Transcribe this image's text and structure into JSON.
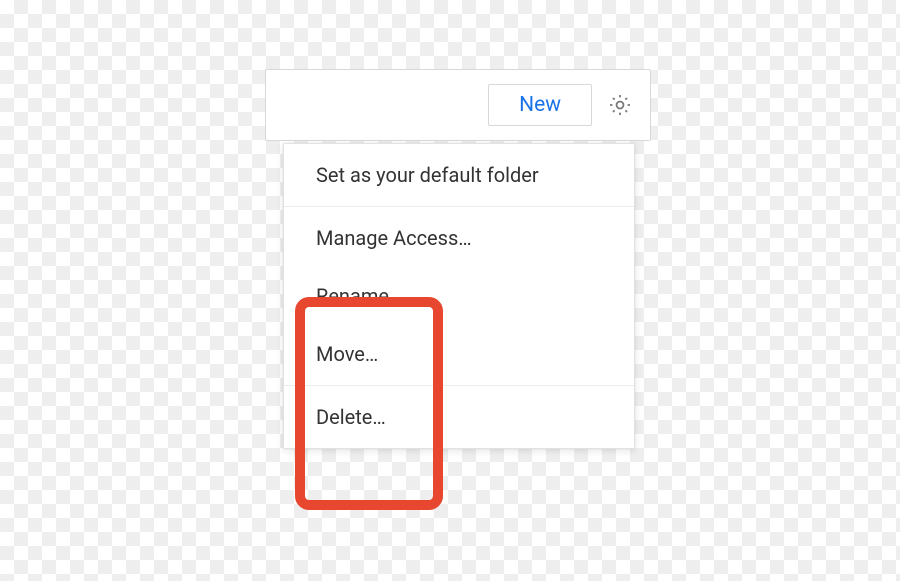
{
  "toolbar": {
    "new_label": "New"
  },
  "menu": {
    "set_default": "Set as your default folder",
    "manage_access": "Manage Access…",
    "rename": "Rename…",
    "move": "Move…",
    "delete": "Delete…"
  }
}
